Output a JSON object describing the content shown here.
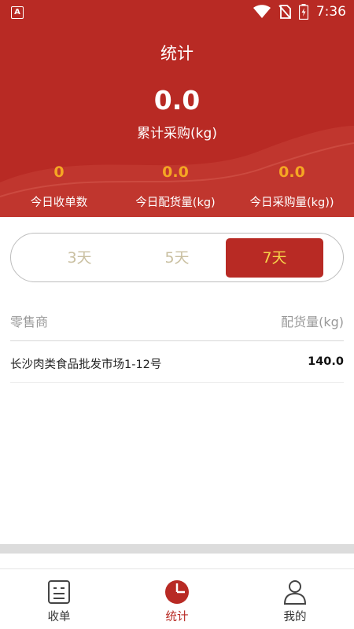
{
  "status_bar": {
    "time": "7:36",
    "left_icon": "a-notification-icon",
    "icons": [
      "wifi-icon",
      "no-sim-icon",
      "battery-charging-icon"
    ]
  },
  "header": {
    "title": "统计",
    "total_value": "0.0",
    "total_label": "累计采购(kg)"
  },
  "stats": [
    {
      "value": "0",
      "label": "今日收单数"
    },
    {
      "value": "0.0",
      "label": "今日配货量(kg)"
    },
    {
      "value": "0.0",
      "label": "今日采购量(kg))"
    }
  ],
  "segment": {
    "options": [
      "3天",
      "5天",
      "7天"
    ],
    "selected": "7天"
  },
  "table": {
    "headers": [
      "零售商",
      "配货量(kg)"
    ],
    "rows": [
      {
        "retailer": "长沙肉类食品批发市场1-12号",
        "amount": "140.0"
      }
    ]
  },
  "tabbar": {
    "items": [
      "收单",
      "统计",
      "我的"
    ],
    "active": "统计"
  },
  "colors": {
    "brand_red": "#b82a24",
    "accent_orange": "#f5a623",
    "selected_text_yellow": "#f7d44a"
  }
}
